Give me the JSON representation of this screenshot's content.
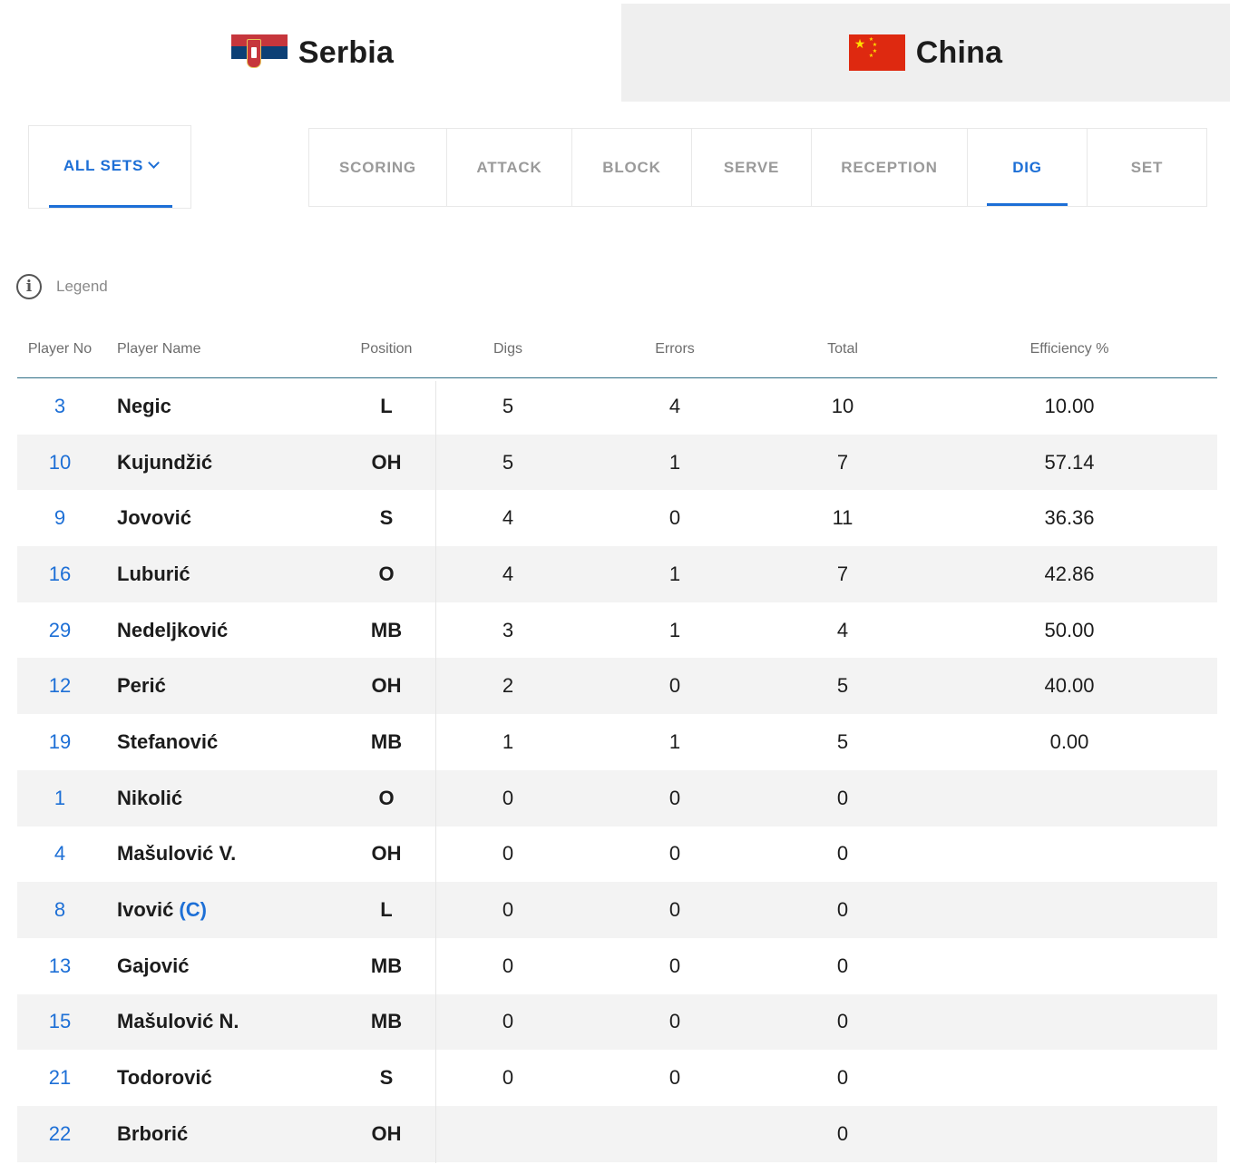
{
  "teams": [
    {
      "name": "Serbia",
      "flag_icon": "serbia-flag-icon",
      "active": true
    },
    {
      "name": "China",
      "flag_icon": "china-flag-icon",
      "active": false
    }
  ],
  "sets_filter": {
    "label": "ALL SETS"
  },
  "stat_tabs": [
    "SCORING",
    "ATTACK",
    "BLOCK",
    "SERVE",
    "RECEPTION",
    "DIG",
    "SET"
  ],
  "active_stat_tab": "DIG",
  "legend": {
    "label": "Legend"
  },
  "table": {
    "headers": {
      "player_no": "Player No",
      "player_name": "Player Name",
      "position": "Position",
      "digs": "Digs",
      "errors": "Errors",
      "total": "Total",
      "efficiency": "Efficiency %"
    },
    "rows": [
      {
        "no": "3",
        "name": "Negic",
        "captain": "",
        "pos": "L",
        "digs": "5",
        "errors": "4",
        "total": "10",
        "eff": "10.00"
      },
      {
        "no": "10",
        "name": "Kujundžić",
        "captain": "",
        "pos": "OH",
        "digs": "5",
        "errors": "1",
        "total": "7",
        "eff": "57.14"
      },
      {
        "no": "9",
        "name": "Jovović",
        "captain": "",
        "pos": "S",
        "digs": "4",
        "errors": "0",
        "total": "11",
        "eff": "36.36"
      },
      {
        "no": "16",
        "name": "Luburić",
        "captain": "",
        "pos": "O",
        "digs": "4",
        "errors": "1",
        "total": "7",
        "eff": "42.86"
      },
      {
        "no": "29",
        "name": "Nedeljković",
        "captain": "",
        "pos": "MB",
        "digs": "3",
        "errors": "1",
        "total": "4",
        "eff": "50.00"
      },
      {
        "no": "12",
        "name": "Perić",
        "captain": "",
        "pos": "OH",
        "digs": "2",
        "errors": "0",
        "total": "5",
        "eff": "40.00"
      },
      {
        "no": "19",
        "name": "Stefanović",
        "captain": "",
        "pos": "MB",
        "digs": "1",
        "errors": "1",
        "total": "5",
        "eff": "0.00"
      },
      {
        "no": "1",
        "name": "Nikolić",
        "captain": "",
        "pos": "O",
        "digs": "0",
        "errors": "0",
        "total": "0",
        "eff": ""
      },
      {
        "no": "4",
        "name": "Mašulović V.",
        "captain": "",
        "pos": "OH",
        "digs": "0",
        "errors": "0",
        "total": "0",
        "eff": ""
      },
      {
        "no": "8",
        "name": "Ivović",
        "captain": "(C)",
        "pos": "L",
        "digs": "0",
        "errors": "0",
        "total": "0",
        "eff": ""
      },
      {
        "no": "13",
        "name": "Gajović",
        "captain": "",
        "pos": "MB",
        "digs": "0",
        "errors": "0",
        "total": "0",
        "eff": ""
      },
      {
        "no": "15",
        "name": "Mašulović N.",
        "captain": "",
        "pos": "MB",
        "digs": "0",
        "errors": "0",
        "total": "0",
        "eff": ""
      },
      {
        "no": "21",
        "name": "Todorović",
        "captain": "",
        "pos": "S",
        "digs": "0",
        "errors": "0",
        "total": "0",
        "eff": ""
      },
      {
        "no": "22",
        "name": "Brborić",
        "captain": "",
        "pos": "OH",
        "digs": "",
        "errors": "",
        "total": "0",
        "eff": ""
      }
    ]
  },
  "colors": {
    "accent": "#1d6fd6",
    "muted": "#9a9a9a",
    "row_alt": "#f3f3f3"
  }
}
